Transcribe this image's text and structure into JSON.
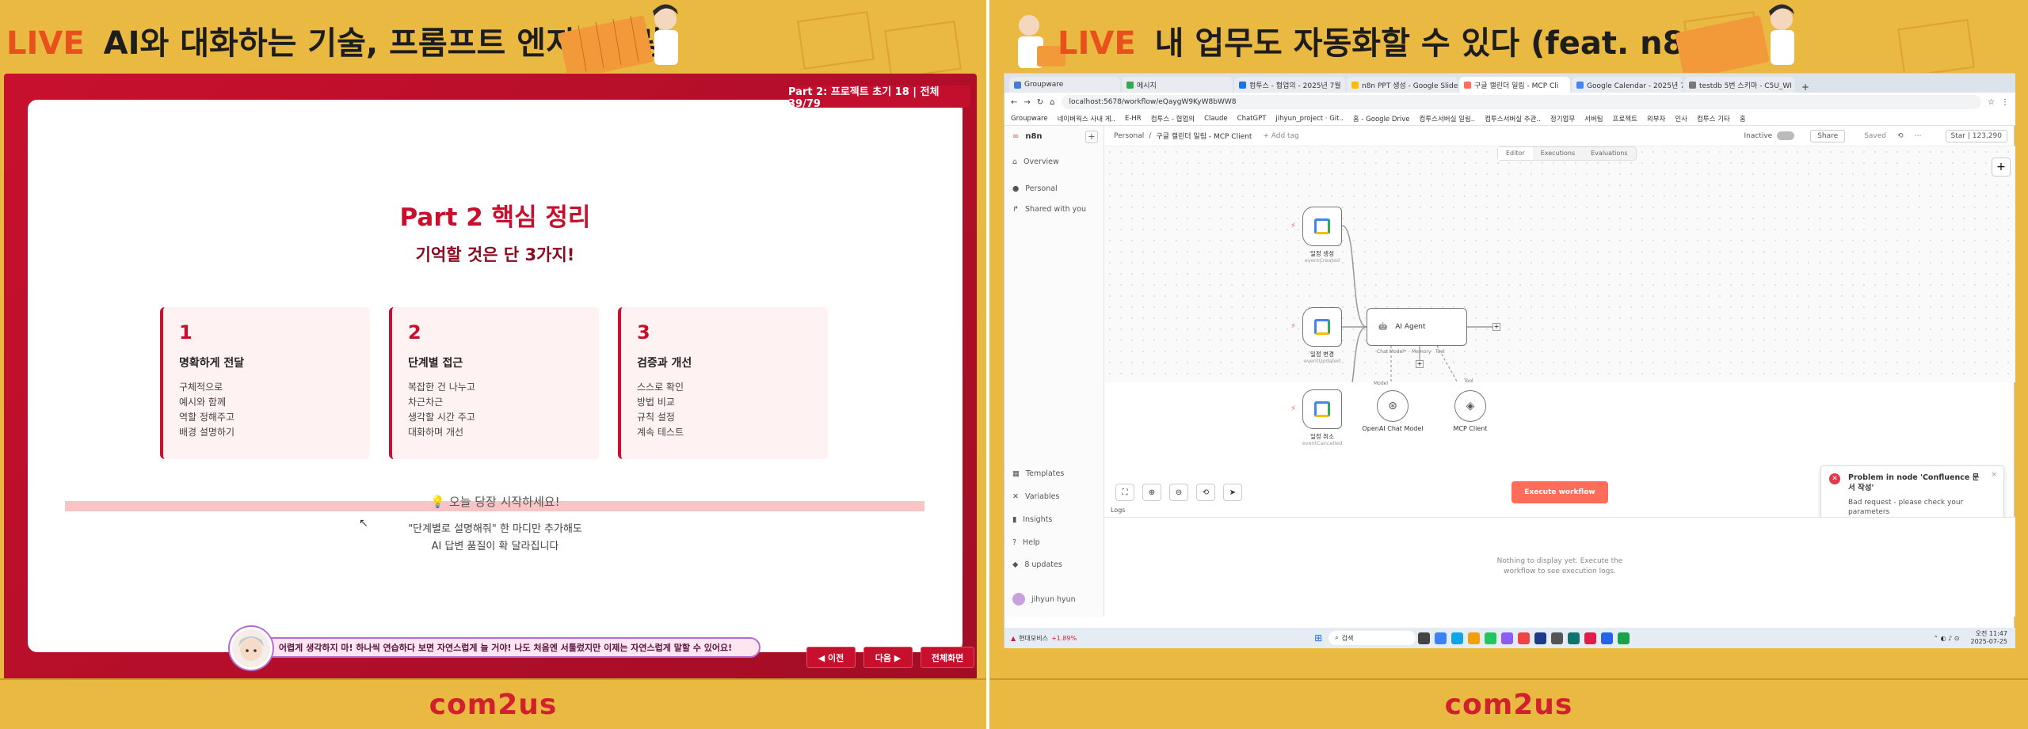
{
  "left": {
    "live": "LIVE",
    "title": "AI와 대화하는 기술, 프롬프트 엔지니어링",
    "slide_tag": "Part 2: 프로젝트 초기 18 | 전체 39/79",
    "slide_title": "Part 2 핵심 정리",
    "slide_subtitle": "기억할 것은 단 3가지!",
    "boxes": [
      {
        "num": "1",
        "title": "명확하게 전달",
        "lines": [
          "구체적으로",
          "예시와 함께",
          "역할 정해주고",
          "배경 설명하기"
        ]
      },
      {
        "num": "2",
        "title": "단계별 접근",
        "lines": [
          "복잡한 건 나누고",
          "차근차근",
          "생각할 시간 주고",
          "대화하며 개선"
        ]
      },
      {
        "num": "3",
        "title": "검증과 개선",
        "lines": [
          "스스로 확인",
          "방법 비교",
          "규칙 설정",
          "계속 테스트"
        ]
      }
    ],
    "start_text": "💡 오늘 당장 시작하세요!",
    "tip_line1": "\"단계별로 설명해줘\" 한 마디만 추가해도",
    "tip_line2": "AI 답변 품질이 확 달라집니다",
    "bubble": "어렵게 생각하지 마! 하나씩 연습하다 보면 자연스럽게 늘 거야! 나도 처음엔 서툴렀지만 이제는 자연스럽게 말할 수 있어요!",
    "prev": "◀ 이전",
    "next": "다음 ▶",
    "fullscreen": "전체화면",
    "logo": "com2us"
  },
  "right": {
    "live": "LIVE",
    "title": "내 업무도 자동화할 수 있다 (feat. n8n)",
    "logo": "com2us",
    "tabs": [
      {
        "label": "Groupware",
        "color": "#4a7bd0"
      },
      {
        "label": "메시지",
        "color": "#34a853"
      },
      {
        "label": "컴투스 - 협업의 - 2025년 7월",
        "color": "#1a73e8"
      },
      {
        "label": "n8n PPT 생성 - Google Slides",
        "color": "#fbbc05"
      },
      {
        "label": "구글 캘린더 일림 - MCP Cli",
        "color": "#ff6d5a"
      },
      {
        "label": "Google Calendar - 2025년 7월",
        "color": "#4285f4"
      },
      {
        "label": "testdb 5번 스키마 - C5U_WI",
        "color": "#777777"
      }
    ],
    "url": "localhost:5678/workflow/eQaygW9KyW8bWW8",
    "bookmarks": [
      "Groupware",
      "네이버웍스 사내 게..",
      "E-HR",
      "컴투스 - 협업의",
      "Claude",
      "ChatGPT",
      "jihyun_project · Git..",
      "홈 - Google Drive",
      "컴투스서버실 일림..",
      "컴투스서버실 추관..",
      "정기업무",
      "서버팀",
      "프로젝트",
      "외부자",
      "인사",
      "컴투스 기타",
      "홈"
    ],
    "app_name": "n8n",
    "sidebar": [
      "Overview",
      "Personal",
      "Shared with you"
    ],
    "sidebar_bottom": [
      "Templates",
      "Variables",
      "Insights",
      "Help",
      "8 updates"
    ],
    "user": "jihyun hyun",
    "breadcrumb_owner": "Personal",
    "breadcrumb_wf": "구글 캘린더 일림 - MCP Client",
    "add_tag": "+ Add tag",
    "inactive": "Inactive",
    "share": "Share",
    "saved": "Saved",
    "star": "Star",
    "star_count": "123,290",
    "view_tabs": [
      "Editor",
      "Executions",
      "Evaluations"
    ],
    "nodes": [
      {
        "label": "일정 생성",
        "sub": "eventCreated"
      },
      {
        "label": "일정 변경",
        "sub": "eventUpdated"
      },
      {
        "label": "일정 취소",
        "sub": "eventCancelled"
      }
    ],
    "agent": "AI Agent",
    "agent_ports": [
      "Chat Model*",
      "Memory",
      "Tool"
    ],
    "model": "OpenAI Chat Model",
    "mcp": "MCP Client",
    "model_port": "Model",
    "tool_port": "Tool",
    "execute": "Execute workflow",
    "toast_title": "Problem in node 'Confluence 문서 작성'",
    "toast_body": "Bad request - please check your parameters",
    "logs_label": "Logs",
    "logs_empty1": "Nothing to display yet. Execute the",
    "logs_empty2": "workflow to see execution logs.",
    "stock_name": "현대모비스",
    "stock_delta": "+1.89%",
    "search": "검색",
    "clock_time": "오전 11:47",
    "clock_date": "2025-07-25"
  }
}
